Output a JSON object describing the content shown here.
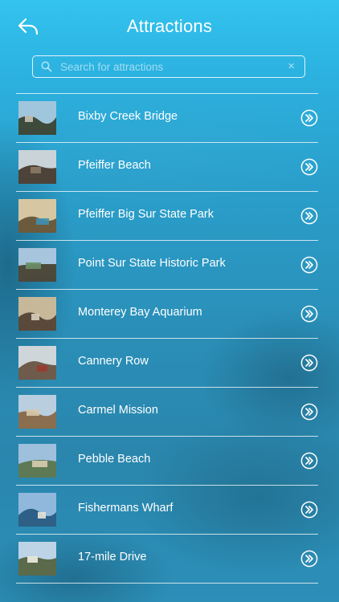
{
  "header": {
    "title": "Attractions",
    "back_icon": "back-reply-arrow-icon"
  },
  "search": {
    "placeholder": "Search for attractions",
    "value": "",
    "clear_label": "×"
  },
  "attractions": [
    {
      "label": "Bixby Creek Bridge",
      "thumb": {
        "sky": "#9fc6dc",
        "land": "#3e4a3a",
        "accent": "#c7c2b8"
      }
    },
    {
      "label": "Pfeiffer Beach",
      "thumb": {
        "sky": "#c9d3d8",
        "land": "#4d4338",
        "accent": "#8b7a66"
      }
    },
    {
      "label": "Pfeiffer Big Sur State Park",
      "thumb": {
        "sky": "#d6c7a2",
        "land": "#6b5a3c",
        "accent": "#3f8fb2"
      }
    },
    {
      "label": "Point Sur State Historic Park",
      "thumb": {
        "sky": "#a7c5dc",
        "land": "#4d4a3c",
        "accent": "#6d8f68"
      }
    },
    {
      "label": "Monterey Bay Aquarium",
      "thumb": {
        "sky": "#c8b89a",
        "land": "#5a4a3a",
        "accent": "#d9cfbe"
      }
    },
    {
      "label": "Cannery Row",
      "thumb": {
        "sky": "#cfd6da",
        "land": "#6e5b4b",
        "accent": "#9a3a30"
      }
    },
    {
      "label": "Carmel Mission",
      "thumb": {
        "sky": "#b9cfe0",
        "land": "#8a6e4f",
        "accent": "#d8c7aa"
      }
    },
    {
      "label": "Pebble Beach",
      "thumb": {
        "sky": "#9ec0dc",
        "land": "#5d7a55",
        "accent": "#d9cdb0"
      }
    },
    {
      "label": "Fishermans Wharf",
      "thumb": {
        "sky": "#8fb8dc",
        "land": "#2e5f86",
        "accent": "#e8e4da"
      }
    },
    {
      "label": "17-mile Drive",
      "thumb": {
        "sky": "#bdd3e6",
        "land": "#5b6a4a",
        "accent": "#f0eee6"
      }
    }
  ],
  "icons": {
    "row_chevron": "double-chevron-right-icon",
    "search": "search-icon"
  },
  "colors": {
    "background_top": "#33c3ee",
    "background_bottom": "#2a86ad",
    "text": "#ffffff"
  }
}
